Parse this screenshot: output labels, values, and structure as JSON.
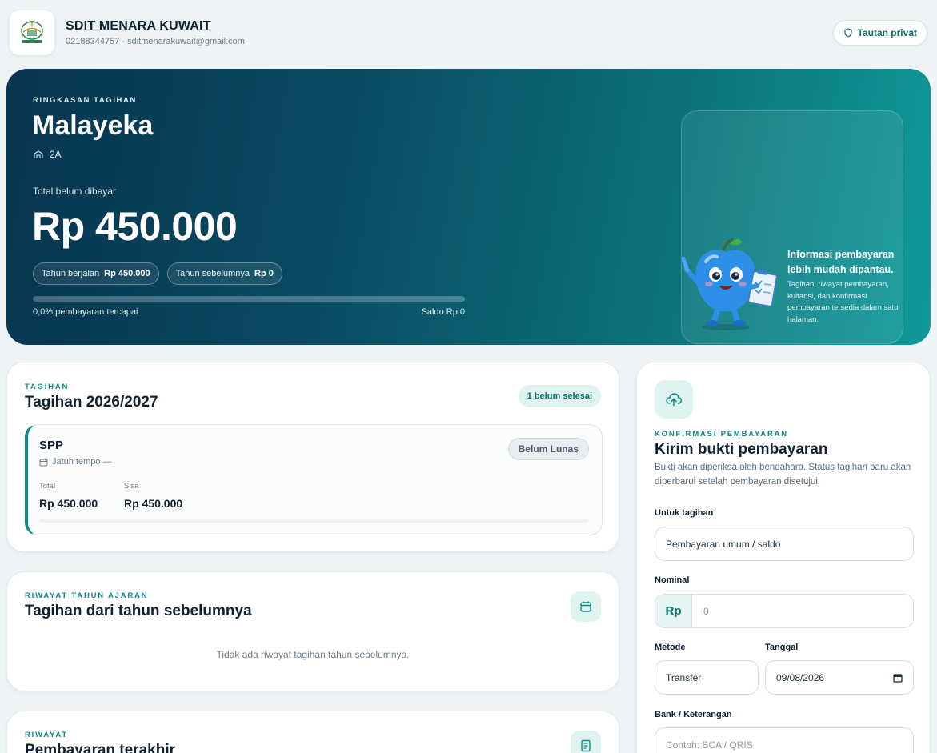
{
  "header": {
    "school_name": "SDIT MENARA KUWAIT",
    "contact": "02188344757 · sditmenarakuwait@gmail.com",
    "private_link_label": "Tautan privat"
  },
  "hero": {
    "eyebrow": "RINGKASAN TAGIHAN",
    "student_name": "Malayeka",
    "class": "2A",
    "total_label": "Total belum dibayar",
    "total_amount": "Rp 450.000",
    "chips": [
      {
        "label": "Tahun berjalan",
        "value": "Rp 450.000"
      },
      {
        "label": "Tahun sebelumnya",
        "value": "Rp 0"
      }
    ],
    "progress_percent": 0,
    "progress_text": "0,0% pembayaran tercapai",
    "balance_text": "Saldo Rp 0",
    "info_title": "Informasi pembayaran lebih mudah dipantau.",
    "info_desc": "Tagihan, riwayat pembayaran, kuitansi, dan konfirmasi pembayaran tersedia dalam satu halaman."
  },
  "bills": {
    "eyebrow": "TAGIHAN",
    "title": "Tagihan 2026/2027",
    "badge": "1 belum selesai",
    "items": [
      {
        "name": "SPP",
        "due": "Jatuh tempo —",
        "status": "Belum Lunas",
        "total_label": "Total",
        "total": "Rp 450.000",
        "remaining_label": "Sisa",
        "remaining": "Rp 450.000",
        "paid_fraction": 0
      }
    ]
  },
  "history": {
    "eyebrow": "RIWAYAT TAHUN AJARAN",
    "title": "Tagihan dari tahun sebelumnya",
    "empty": "Tidak ada riwayat tagihan tahun sebelumnya."
  },
  "payments": {
    "eyebrow": "RIWAYAT",
    "title": "Pembayaran terakhir"
  },
  "confirm": {
    "eyebrow": "KONFIRMASI PEMBAYARAN",
    "title": "Kirim bukti pembayaran",
    "desc": "Bukti akan diperiksa oleh bendahara. Status tagihan baru akan diperbarui setelah pembayaran disetujui.",
    "bill_label": "Untuk tagihan",
    "bill_value": "Pembayaran umum / saldo",
    "amount_label": "Nominal",
    "amount_prefix": "Rp",
    "amount_placeholder": "0",
    "method_label": "Metode",
    "method_value": "Transfer",
    "date_label": "Tanggal",
    "date_value": "09/08/2026",
    "bank_label": "Bank / Keterangan",
    "bank_placeholder": "Contoh: BCA / QRIS"
  },
  "colors": {
    "accent": "#0c8a86",
    "hero_start": "#07344e",
    "hero_end": "#109a99",
    "status_unpaid": "#4a5868"
  },
  "icons": [
    "school-logo-icon",
    "shield-icon",
    "school-building-icon",
    "calendar-icon",
    "receipt-icon",
    "cloud-upload-icon",
    "mascot-apple-icon"
  ]
}
